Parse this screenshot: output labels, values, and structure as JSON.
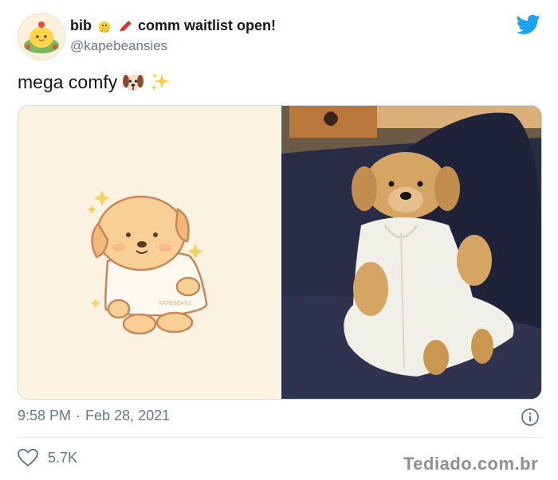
{
  "author": {
    "name_start": "bib",
    "name_end": "comm waitlist open!",
    "name_emojis": [
      "baby-chick-emoji",
      "crayon-emoji"
    ],
    "handle": "@kapebeansies"
  },
  "tweet": {
    "text": "mega comfy",
    "text_emojis": [
      "dog-face-emoji",
      "sparkles-emoji"
    ]
  },
  "media": {
    "left_image": "puppy-drawing",
    "right_image": "puppy-photo",
    "drawing_watermark": "KAPEBEANS"
  },
  "meta": {
    "time": "9:58 PM",
    "separator": "·",
    "date": "Feb 28, 2021"
  },
  "engagement": {
    "like_count": "5.7K"
  },
  "watermark": "Tediado.com.br",
  "colors": {
    "twitter_blue": "#1DA1F2",
    "secondary_text": "#657786",
    "border": "#cfd9de"
  }
}
